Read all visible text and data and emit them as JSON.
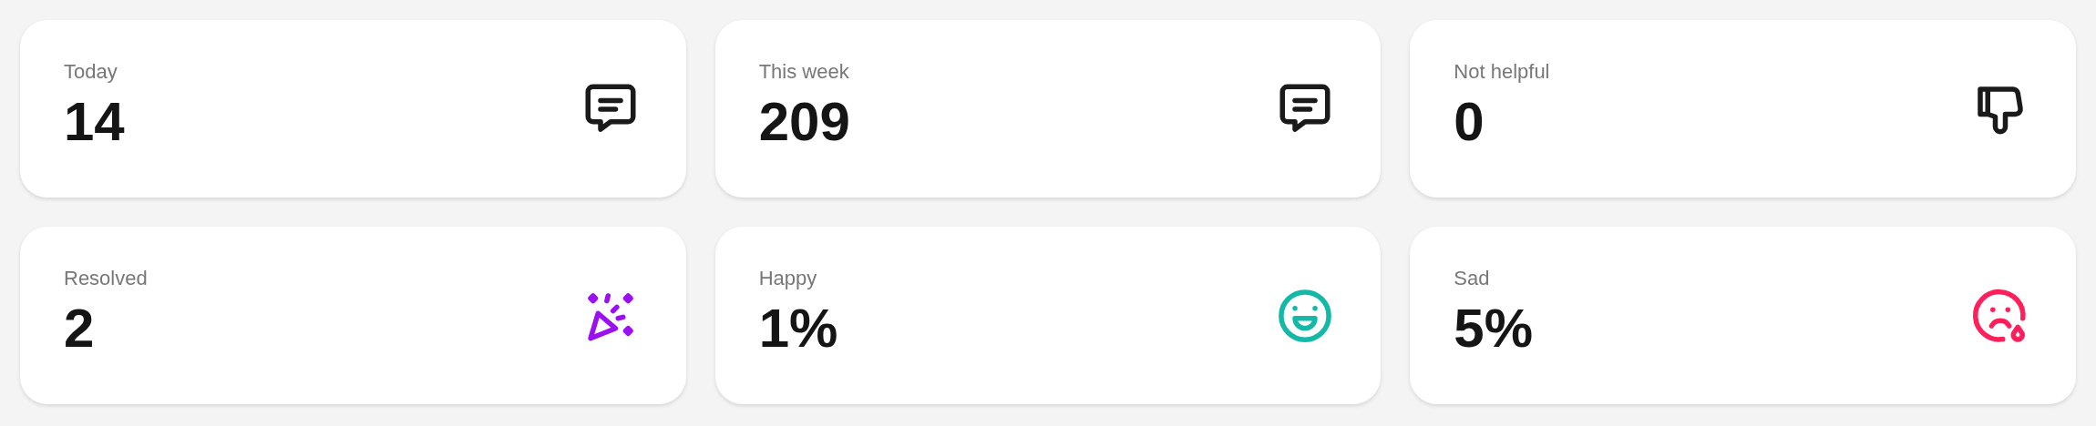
{
  "cards": [
    {
      "label": "Today",
      "value": "14",
      "kind": "chat",
      "color": "#1a1a1a"
    },
    {
      "label": "This week",
      "value": "209",
      "kind": "chat",
      "color": "#1a1a1a"
    },
    {
      "label": "Not helpful",
      "value": "0",
      "kind": "thumbs-down",
      "color": "#1a1a1a"
    },
    {
      "label": "Resolved",
      "value": "2",
      "kind": "party",
      "color": "#9b10f0"
    },
    {
      "label": "Happy",
      "value": "1%",
      "kind": "happy",
      "color": "#14b8a6"
    },
    {
      "label": "Sad",
      "value": "5%",
      "kind": "sad",
      "color": "#ff1f5a"
    }
  ]
}
